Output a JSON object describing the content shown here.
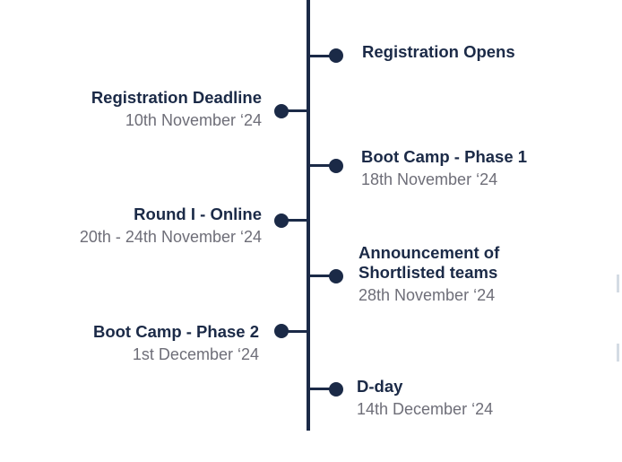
{
  "colors": {
    "accent": "#1b2a47",
    "date_text": "#6e6e78",
    "background": "#ffffff"
  },
  "events": [
    {
      "side": "right",
      "title": "Registration Opens",
      "date": ""
    },
    {
      "side": "left",
      "title": "Registration Deadline",
      "date": "10th November ‘24"
    },
    {
      "side": "right",
      "title": "Boot Camp - Phase 1",
      "date": "18th November ‘24"
    },
    {
      "side": "left",
      "title": "Round I - Online",
      "date": "20th - 24th November ‘24"
    },
    {
      "side": "right",
      "title": "Announcement of\nShortlisted teams",
      "date": "28th November ‘24"
    },
    {
      "side": "left",
      "title": "Boot Camp - Phase 2",
      "date": "1st December ‘24"
    },
    {
      "side": "right",
      "title": "D-day",
      "date": "14th December ‘24"
    }
  ]
}
